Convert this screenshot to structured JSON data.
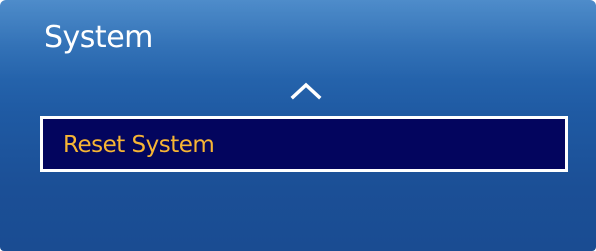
{
  "header": {
    "title": "System"
  },
  "menu": {
    "scroll_up_icon": "chevron-up-icon",
    "items": [
      {
        "label": "Reset System",
        "selected": true
      }
    ]
  },
  "colors": {
    "panel_background": "#1f5aa3",
    "selected_background": "#03055e",
    "selected_text": "#f7b534",
    "title_text": "#ffffff",
    "focus_border": "#ffffff"
  }
}
